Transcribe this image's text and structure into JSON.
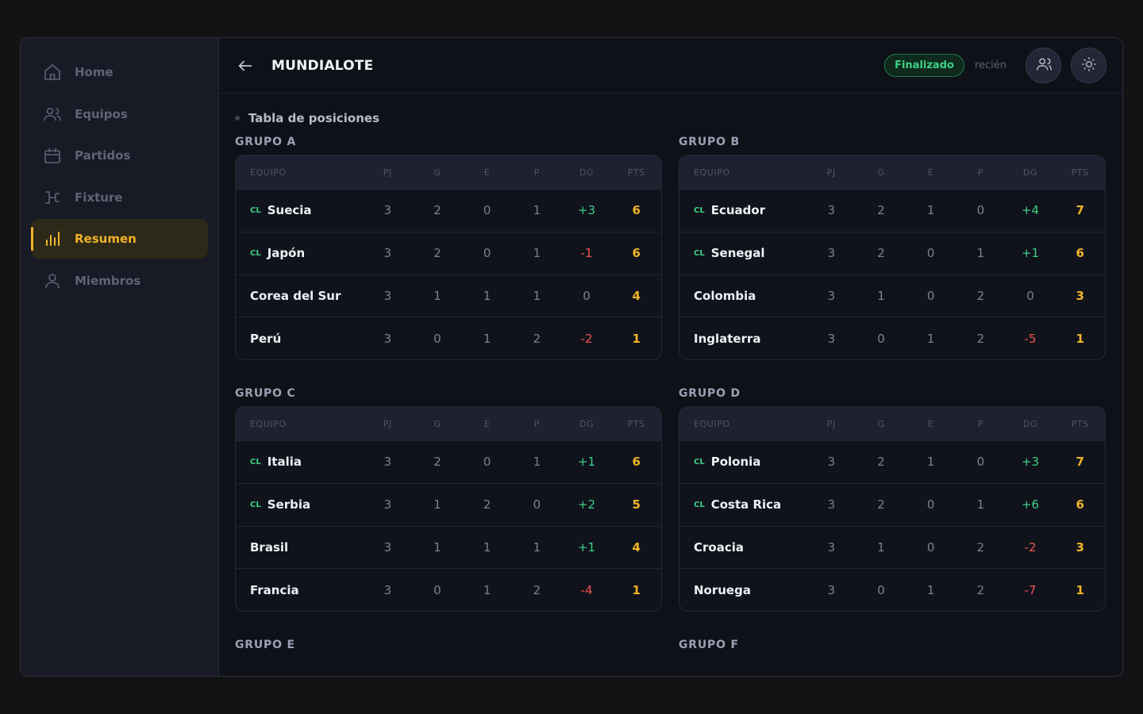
{
  "nav": [
    {
      "label": "Home",
      "icon": "home-icon",
      "active": false
    },
    {
      "label": "Equipos",
      "icon": "users-icon",
      "active": false
    },
    {
      "label": "Partidos",
      "icon": "calendar-icon",
      "active": false
    },
    {
      "label": "Fixture",
      "icon": "bracket-icon",
      "active": false
    },
    {
      "label": "Resumen",
      "icon": "bar-chart-icon",
      "active": true
    },
    {
      "label": "Miembros",
      "icon": "person-icon",
      "active": false
    }
  ],
  "header": {
    "title": "MUNDIALOTE",
    "status": "Finalizado",
    "updated": "recién"
  },
  "section_title": "Tabla de posiciones",
  "columns": [
    "EQUIPO",
    "PJ",
    "G",
    "E",
    "P",
    "DG",
    "PTS"
  ],
  "tag_label": "CL",
  "groups": [
    {
      "title": "GRUPO A",
      "rows": [
        {
          "team": "Suecia",
          "cl": true,
          "pj": "3",
          "g": "2",
          "e": "0",
          "p": "1",
          "dg": "+3",
          "pts": "6"
        },
        {
          "team": "Japón",
          "cl": true,
          "pj": "3",
          "g": "2",
          "e": "0",
          "p": "1",
          "dg": "-1",
          "pts": "6"
        },
        {
          "team": "Corea del Sur",
          "cl": false,
          "pj": "3",
          "g": "1",
          "e": "1",
          "p": "1",
          "dg": "0",
          "pts": "4"
        },
        {
          "team": "Perú",
          "cl": false,
          "pj": "3",
          "g": "0",
          "e": "1",
          "p": "2",
          "dg": "-2",
          "pts": "1"
        }
      ]
    },
    {
      "title": "GRUPO B",
      "rows": [
        {
          "team": "Ecuador",
          "cl": true,
          "pj": "3",
          "g": "2",
          "e": "1",
          "p": "0",
          "dg": "+4",
          "pts": "7"
        },
        {
          "team": "Senegal",
          "cl": true,
          "pj": "3",
          "g": "2",
          "e": "0",
          "p": "1",
          "dg": "+1",
          "pts": "6"
        },
        {
          "team": "Colombia",
          "cl": false,
          "pj": "3",
          "g": "1",
          "e": "0",
          "p": "2",
          "dg": "0",
          "pts": "3"
        },
        {
          "team": "Inglaterra",
          "cl": false,
          "pj": "3",
          "g": "0",
          "e": "1",
          "p": "2",
          "dg": "-5",
          "pts": "1"
        }
      ]
    },
    {
      "title": "GRUPO C",
      "rows": [
        {
          "team": "Italia",
          "cl": true,
          "pj": "3",
          "g": "2",
          "e": "0",
          "p": "1",
          "dg": "+1",
          "pts": "6"
        },
        {
          "team": "Serbia",
          "cl": true,
          "pj": "3",
          "g": "1",
          "e": "2",
          "p": "0",
          "dg": "+2",
          "pts": "5"
        },
        {
          "team": "Brasil",
          "cl": false,
          "pj": "3",
          "g": "1",
          "e": "1",
          "p": "1",
          "dg": "+1",
          "pts": "4"
        },
        {
          "team": "Francia",
          "cl": false,
          "pj": "3",
          "g": "0",
          "e": "1",
          "p": "2",
          "dg": "-4",
          "pts": "1"
        }
      ]
    },
    {
      "title": "GRUPO D",
      "rows": [
        {
          "team": "Polonia",
          "cl": true,
          "pj": "3",
          "g": "2",
          "e": "1",
          "p": "0",
          "dg": "+3",
          "pts": "7"
        },
        {
          "team": "Costa Rica",
          "cl": true,
          "pj": "3",
          "g": "2",
          "e": "0",
          "p": "1",
          "dg": "+6",
          "pts": "6"
        },
        {
          "team": "Croacia",
          "cl": false,
          "pj": "3",
          "g": "1",
          "e": "0",
          "p": "2",
          "dg": "-2",
          "pts": "3"
        },
        {
          "team": "Noruega",
          "cl": false,
          "pj": "3",
          "g": "0",
          "e": "1",
          "p": "2",
          "dg": "-7",
          "pts": "1"
        }
      ]
    },
    {
      "title": "GRUPO E",
      "rows": []
    },
    {
      "title": "GRUPO F",
      "rows": []
    }
  ]
}
